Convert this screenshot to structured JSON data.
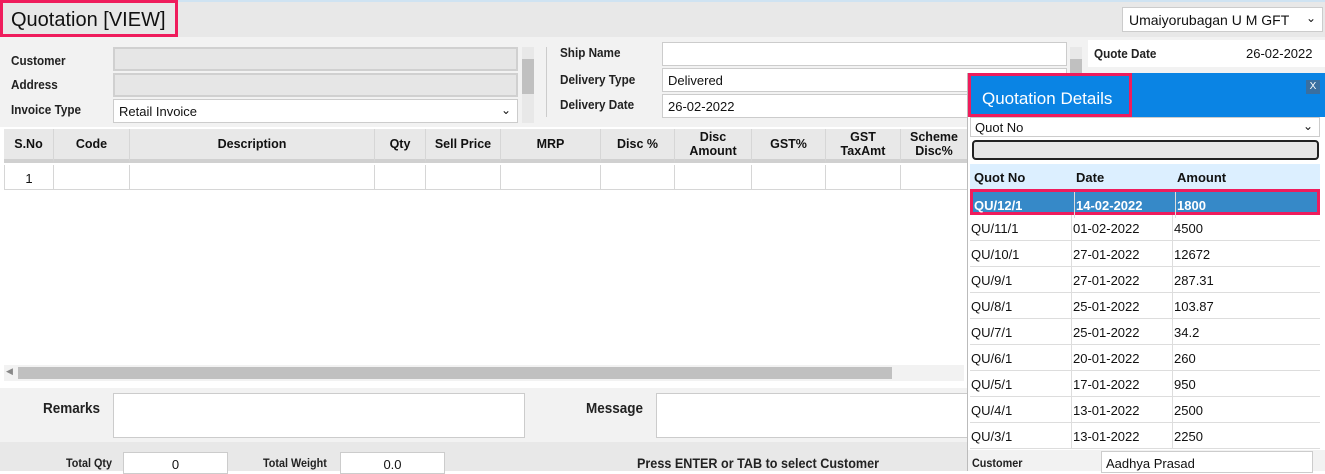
{
  "header": {
    "title": "Quotation [VIEW]",
    "branch": "Umaiyorubagan U M GFT"
  },
  "form": {
    "customer_label": "Customer",
    "address_label": "Address",
    "invoice_type_label": "Invoice Type",
    "invoice_type": "Retail Invoice",
    "ship_name_label": "Ship Name",
    "ship_name": "",
    "delivery_type_label": "Delivery Type",
    "delivery_type": "Delivered",
    "delivery_date_label": "Delivery Date",
    "delivery_date": "26-02-2022",
    "quote_date_label": "Quote Date",
    "quote_date": "26-02-2022"
  },
  "grid": {
    "columns": [
      "S.No",
      "Code",
      "Description",
      "Qty",
      "Sell Price",
      "MRP",
      "Disc %",
      "Disc Amount",
      "GST%",
      "GST TaxAmt",
      "Scheme Disc%"
    ],
    "rows": [
      [
        "1",
        "",
        "",
        "",
        "",
        "",
        "",
        "",
        "",
        "",
        ""
      ]
    ]
  },
  "remarks": {
    "remarks_label": "Remarks",
    "message_label": "Message"
  },
  "footer": {
    "total_qty_label": "Total Qty",
    "total_qty": "0",
    "total_weight_label": "Total Weight",
    "total_weight": "0.0",
    "hint": "Press ENTER or TAB to select Customer"
  },
  "popup": {
    "title": "Quotation Details",
    "close": "X",
    "filter": "Quot No",
    "search": "",
    "columns": [
      "Quot No",
      "Date",
      "Amount"
    ],
    "rows": [
      [
        "QU/12/1",
        "14-02-2022",
        "1800"
      ],
      [
        "QU/11/1",
        "01-02-2022",
        "4500"
      ],
      [
        "QU/10/1",
        "27-01-2022",
        "12672"
      ],
      [
        "QU/9/1",
        "27-01-2022",
        "287.31"
      ],
      [
        "QU/8/1",
        "25-01-2022",
        "103.87"
      ],
      [
        "QU/7/1",
        "25-01-2022",
        "34.2"
      ],
      [
        "QU/6/1",
        "20-01-2022",
        "260"
      ],
      [
        "QU/5/1",
        "17-01-2022",
        "950"
      ],
      [
        "QU/4/1",
        "13-01-2022",
        "2500"
      ],
      [
        "QU/3/1",
        "13-01-2022",
        "2250"
      ]
    ],
    "selected_index": 0,
    "customer_label": "Customer",
    "customer": "Aadhya Prasad"
  },
  "colors": {
    "accent": "#0a84e4",
    "highlight": "#ef1c5c",
    "selected_row": "#3689c8"
  }
}
